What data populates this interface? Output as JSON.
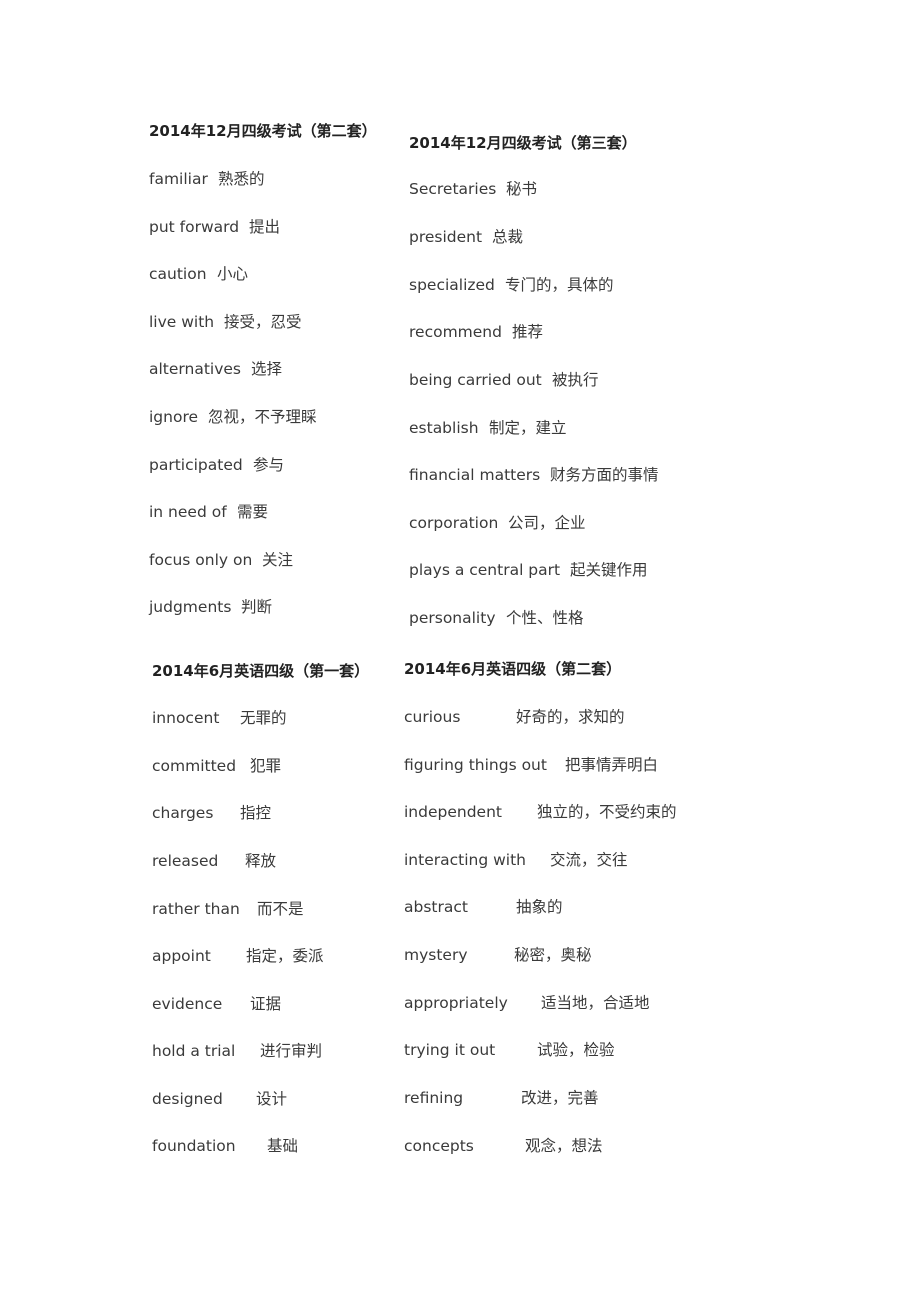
{
  "sections": [
    {
      "heading": "2014年12月四级考试（第二套）",
      "items": [
        {
          "en": "familiar",
          "zh": "熟悉的"
        },
        {
          "en": "put forward",
          "zh": "提出"
        },
        {
          "en": "caution",
          "zh": "小心"
        },
        {
          "en": "live with",
          "zh": "接受，忍受"
        },
        {
          "en": "alternatives",
          "zh": "选择"
        },
        {
          "en": "ignore",
          "zh": "忽视，不予理睬"
        },
        {
          "en": "participated",
          "zh": "参与"
        },
        {
          "en": "in need of",
          "zh": "需要"
        },
        {
          "en": "focus only on",
          "zh": "关注"
        },
        {
          "en": "judgments",
          "zh": "判断"
        }
      ]
    },
    {
      "heading": "2014年12月四级考试（第三套）",
      "items": [
        {
          "en": "Secretaries",
          "zh": "秘书"
        },
        {
          "en": "president",
          "zh": "总裁"
        },
        {
          "en": "specialized",
          "zh": "专门的，具体的"
        },
        {
          "en": "recommend",
          "zh": "推荐"
        },
        {
          "en": "being carried out",
          "zh": "被执行"
        },
        {
          "en": "establish",
          "zh": "制定，建立"
        },
        {
          "en": "financial matters",
          "zh": "财务方面的事情"
        },
        {
          "en": "corporation",
          "zh": "公司，企业"
        },
        {
          "en": "plays a central part",
          "zh": "起关键作用"
        },
        {
          "en": "personality",
          "zh": "个性、性格"
        }
      ]
    },
    {
      "heading": "2014年6月英语四级（第一套）",
      "items": [
        {
          "en": "innocent",
          "zh": "无罪的"
        },
        {
          "en": "committed",
          "zh": "犯罪"
        },
        {
          "en": "charges",
          "zh": "指控"
        },
        {
          "en": "released",
          "zh": "释放"
        },
        {
          "en": "rather than",
          "zh": "而不是"
        },
        {
          "en": "appoint",
          "zh": "指定，委派"
        },
        {
          "en": "evidence",
          "zh": "证据"
        },
        {
          "en": "hold a trial",
          "zh": "进行审判"
        },
        {
          "en": "designed",
          "zh": "设计"
        },
        {
          "en": "foundation",
          "zh": "基础"
        }
      ]
    },
    {
      "heading": "2014年6月英语四级（第二套）",
      "items": [
        {
          "en": "curious",
          "zh": "好奇的，求知的"
        },
        {
          "en": "figuring things out",
          "zh": "把事情弄明白"
        },
        {
          "en": "independent",
          "zh": "独立的，不受约束的"
        },
        {
          "en": "interacting with",
          "zh": "交流，交往"
        },
        {
          "en": "abstract",
          "zh": "抽象的"
        },
        {
          "en": "mystery",
          "zh": "秘密，奥秘"
        },
        {
          "en": "appropriately",
          "zh": "适当地，合适地"
        },
        {
          "en": "trying it out",
          "zh": "试验，检验"
        },
        {
          "en": "refining",
          "zh": "改进，完善"
        },
        {
          "en": "concepts",
          "zh": "观念，想法"
        }
      ]
    }
  ]
}
